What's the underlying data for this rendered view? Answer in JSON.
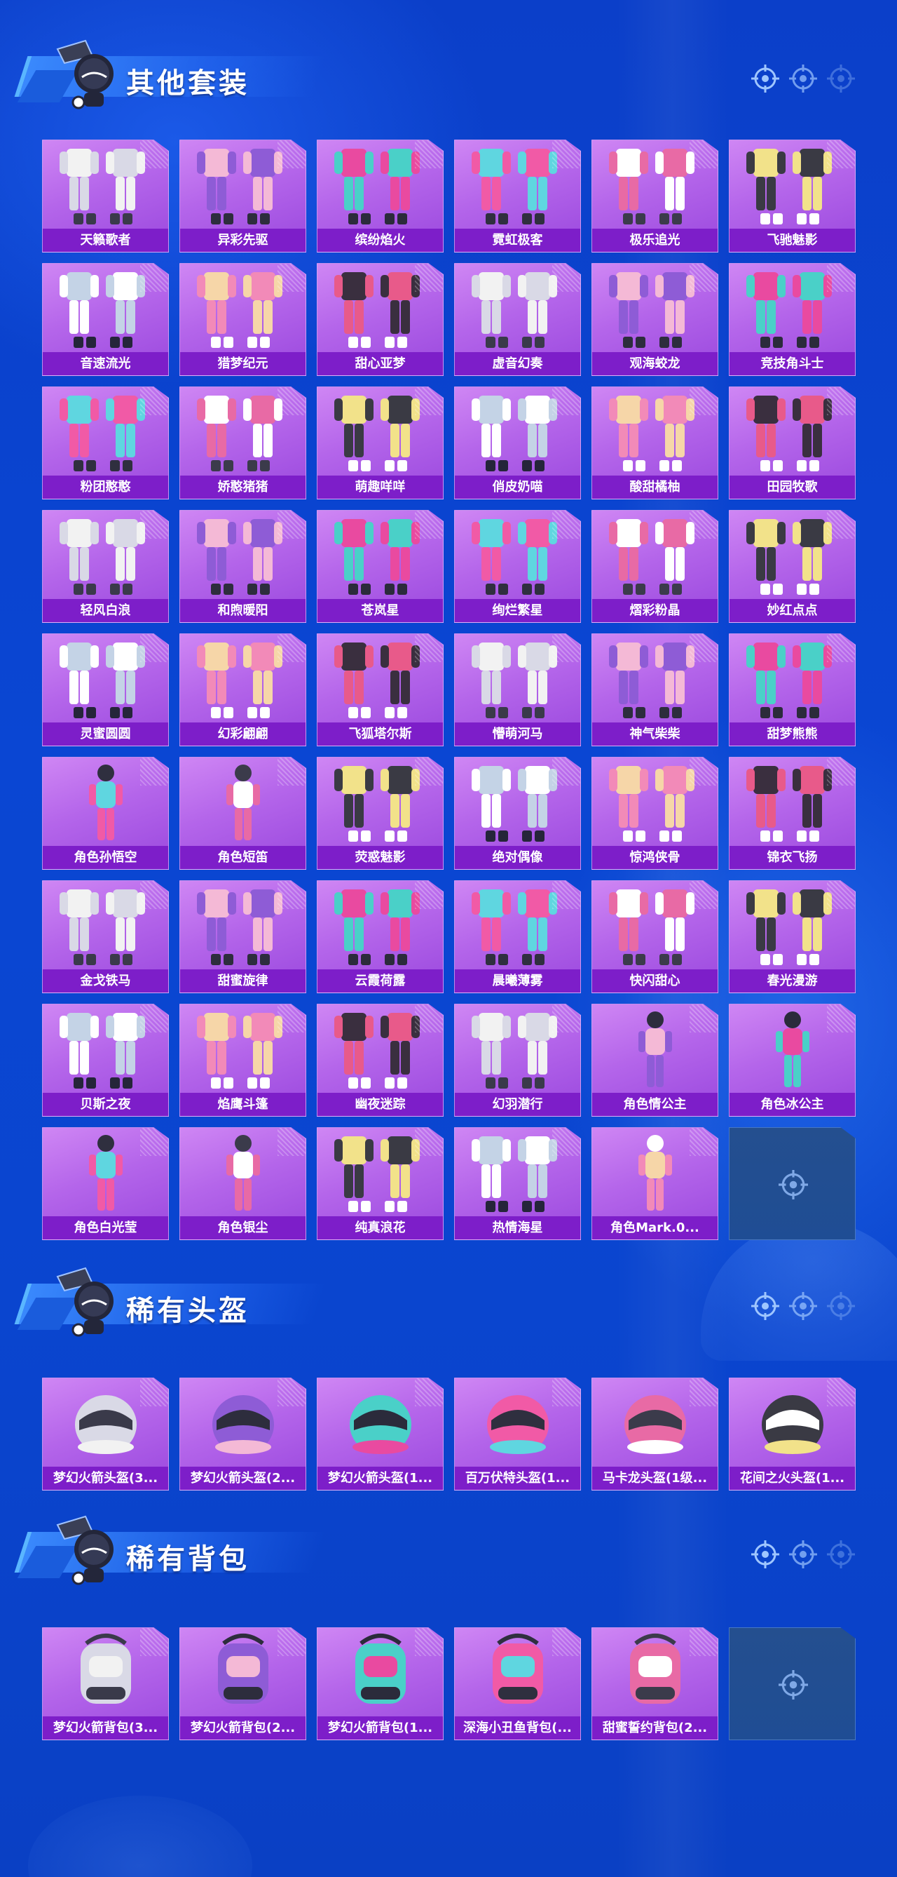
{
  "sections": {
    "suits": {
      "title": "其他套装",
      "items": [
        {
          "name": "天籁歌者",
          "art": "suit"
        },
        {
          "name": "异彩先驱",
          "art": "suit"
        },
        {
          "name": "缤纷焰火",
          "art": "suit"
        },
        {
          "name": "霓虹极客",
          "art": "suit"
        },
        {
          "name": "极乐追光",
          "art": "suit"
        },
        {
          "name": "飞驰魅影",
          "art": "suit"
        },
        {
          "name": "音速流光",
          "art": "suit"
        },
        {
          "name": "猎梦纪元",
          "art": "suit"
        },
        {
          "name": "甜心亚梦",
          "art": "suit"
        },
        {
          "name": "虚音幻奏",
          "art": "suit"
        },
        {
          "name": "观海蛟龙",
          "art": "suit"
        },
        {
          "name": "竞技角斗士",
          "art": "suit"
        },
        {
          "name": "粉团憨憨",
          "art": "suit"
        },
        {
          "name": "娇憨猪猪",
          "art": "suit"
        },
        {
          "name": "萌趣咩咩",
          "art": "suit"
        },
        {
          "name": "俏皮奶喵",
          "art": "suit"
        },
        {
          "name": "酸甜橘柚",
          "art": "suit"
        },
        {
          "name": "田园牧歌",
          "art": "suit"
        },
        {
          "name": "轻风白浪",
          "art": "suit"
        },
        {
          "name": "和煦暖阳",
          "art": "suit"
        },
        {
          "name": "苍岚星",
          "art": "suit"
        },
        {
          "name": "绚烂繁星",
          "art": "suit"
        },
        {
          "name": "熠彩粉晶",
          "art": "suit"
        },
        {
          "name": "妙红点点",
          "art": "suit"
        },
        {
          "name": "灵蜜圆圆",
          "art": "suit"
        },
        {
          "name": "幻彩翩翩",
          "art": "suit"
        },
        {
          "name": "飞狐塔尔斯",
          "art": "suit"
        },
        {
          "name": "懵萌河马",
          "art": "suit"
        },
        {
          "name": "神气柴柴",
          "art": "suit"
        },
        {
          "name": "甜梦熊熊",
          "art": "suit"
        },
        {
          "name": "角色孙悟空",
          "art": "figure"
        },
        {
          "name": "角色短笛",
          "art": "figure"
        },
        {
          "name": "荧惑魅影",
          "art": "suit"
        },
        {
          "name": "绝对偶像",
          "art": "suit"
        },
        {
          "name": "惊鸿侠骨",
          "art": "suit"
        },
        {
          "name": "锦衣飞扬",
          "art": "suit"
        },
        {
          "name": "金戈铁马",
          "art": "suit"
        },
        {
          "name": "甜蜜旋律",
          "art": "suit"
        },
        {
          "name": "云霞荷露",
          "art": "suit"
        },
        {
          "name": "晨曦薄雾",
          "art": "suit"
        },
        {
          "name": "快闪甜心",
          "art": "suit"
        },
        {
          "name": "春光漫游",
          "art": "suit"
        },
        {
          "name": "贝斯之夜",
          "art": "suit"
        },
        {
          "name": "焰鹰斗篷",
          "art": "suit"
        },
        {
          "name": "幽夜迷踪",
          "art": "suit"
        },
        {
          "name": "幻羽潜行",
          "art": "suit"
        },
        {
          "name": "角色情公主",
          "art": "figure"
        },
        {
          "name": "角色冰公主",
          "art": "figure"
        },
        {
          "name": "角色白光莹",
          "art": "figure"
        },
        {
          "name": "角色银尘",
          "art": "figure"
        },
        {
          "name": "纯真浪花",
          "art": "suit"
        },
        {
          "name": "热情海星",
          "art": "suit"
        },
        {
          "name": "角色Mark.0...",
          "art": "figure"
        }
      ]
    },
    "helmets": {
      "title": "稀有头盔",
      "items": [
        {
          "name": "梦幻火箭头盔(3...",
          "art": "helmet"
        },
        {
          "name": "梦幻火箭头盔(2...",
          "art": "helmet"
        },
        {
          "name": "梦幻火箭头盔(1...",
          "art": "helmet"
        },
        {
          "name": "百万伏特头盔(1...",
          "art": "helmet"
        },
        {
          "name": "马卡龙头盔(1级...",
          "art": "helmet"
        },
        {
          "name": "花间之火头盔(1...",
          "art": "helmet"
        }
      ]
    },
    "backpacks": {
      "title": "稀有背包",
      "items": [
        {
          "name": "梦幻火箭背包(3...",
          "art": "backpack"
        },
        {
          "name": "梦幻火箭背包(2...",
          "art": "backpack"
        },
        {
          "name": "梦幻火箭背包(1...",
          "art": "backpack"
        },
        {
          "name": "深海小丑鱼背包(...",
          "art": "backpack"
        },
        {
          "name": "甜蜜誓约背包(2...",
          "art": "backpack"
        }
      ]
    }
  },
  "colors": {
    "background": "#0b43cf",
    "card": "#b465ea",
    "label_bar": "#7d1ec9",
    "empty_slot": "#244f8f"
  },
  "icons": {
    "section_mascot": "pan-mascot-icon",
    "section_target": "crosshair-target-icon",
    "empty_slot": "crosshair-target-icon"
  }
}
